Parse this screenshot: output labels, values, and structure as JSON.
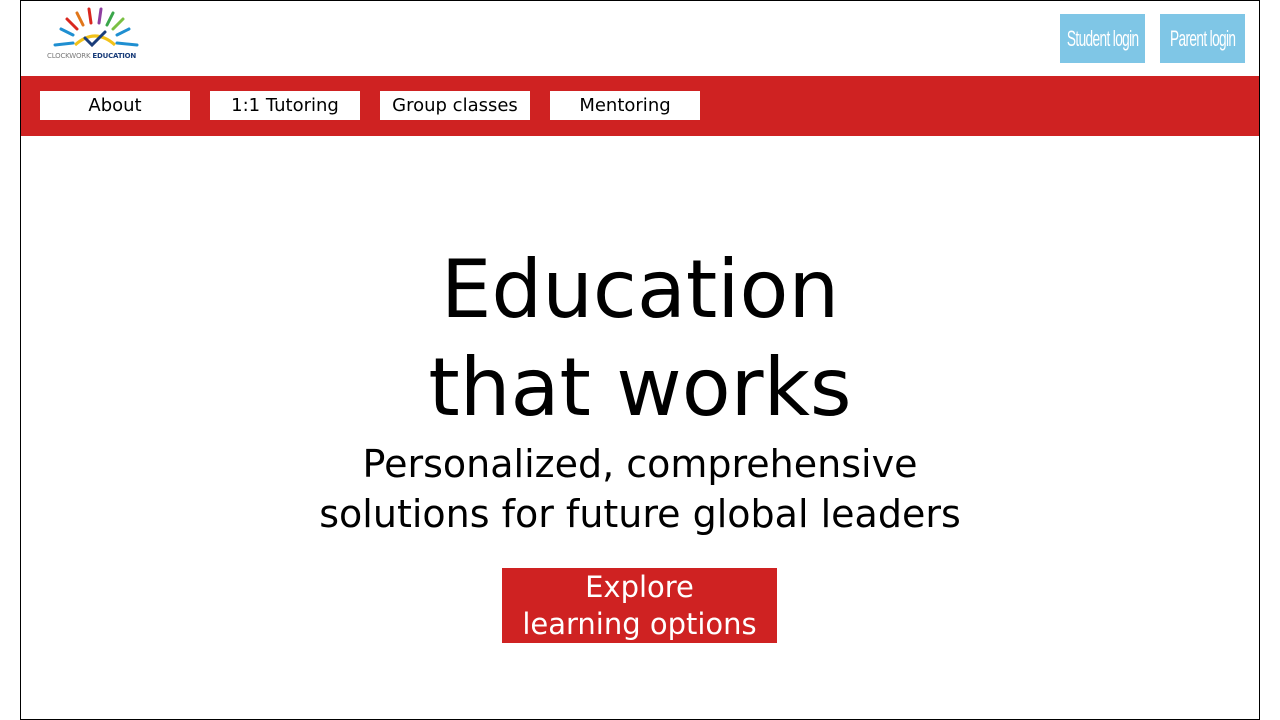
{
  "brand": {
    "logo_icon": "clockwork-sun-logo",
    "logo_text_light": "CLOCKWORK",
    "logo_text_bold": "EDUCATION"
  },
  "header": {
    "student_login": "Student login",
    "parent_login": "Parent login"
  },
  "nav": {
    "items": [
      {
        "label": "About"
      },
      {
        "label": "1:1 Tutoring"
      },
      {
        "label": "Group classes"
      },
      {
        "label": "Mentoring"
      }
    ]
  },
  "hero": {
    "title_line1": "Education",
    "title_line2": "that works",
    "subtitle_line1": "Personalized, comprehensive",
    "subtitle_line2": "solutions for future global leaders",
    "cta_line1": "Explore",
    "cta_line2": "learning options"
  },
  "colors": {
    "nav_background": "#cf2222",
    "cta_background": "#cf2222",
    "login_button": "#7fc6e6"
  }
}
